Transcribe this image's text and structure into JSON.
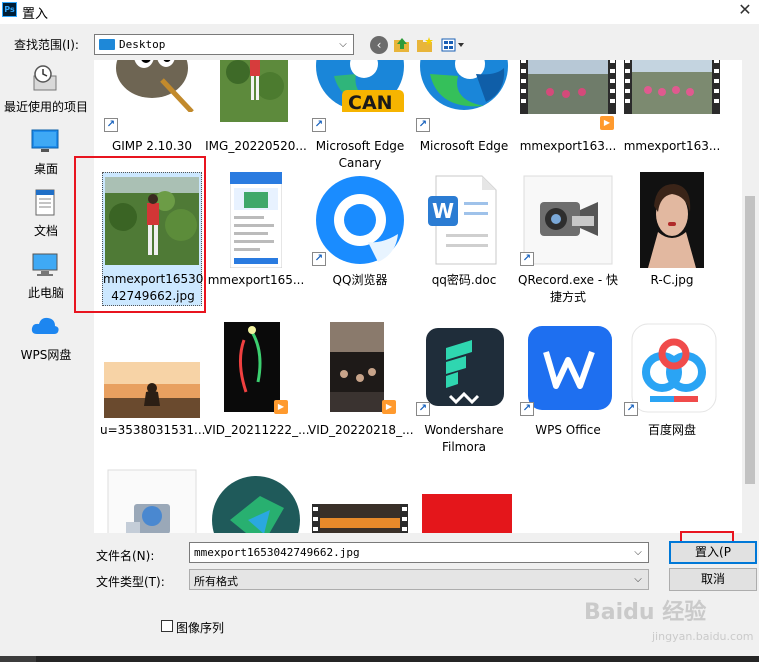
{
  "window": {
    "title": "置入",
    "app_icon": "Ps",
    "close_glyph": "✕"
  },
  "location": {
    "label": "查找范围(I):",
    "value": "Desktop"
  },
  "places": [
    {
      "label": "最近使用的项目",
      "icon": "recent-icon"
    },
    {
      "label": "桌面",
      "icon": "desktop-icon"
    },
    {
      "label": "文档",
      "icon": "documents-icon"
    },
    {
      "label": "此电脑",
      "icon": "computer-icon"
    },
    {
      "label": "WPS网盘",
      "icon": "cloud-icon"
    }
  ],
  "files": {
    "row1": [
      {
        "name": "GIMP 2.10.30"
      },
      {
        "name": "IMG_20220520..."
      },
      {
        "name": "Microsoft Edge\nCanary",
        "badge": "CAN"
      },
      {
        "name": "Microsoft Edge"
      },
      {
        "name": "mmexport163..."
      },
      {
        "name": "mmexport163..."
      }
    ],
    "row2": [
      {
        "name": "mmexport16530\n42749662.jpg"
      },
      {
        "name": "mmexport165..."
      },
      {
        "name": "QQ浏览器"
      },
      {
        "name": "qq密码.doc"
      },
      {
        "name": "QRecord.exe - 快\n捷方式"
      },
      {
        "name": "R-C.jpg"
      }
    ],
    "row3": [
      {
        "name": "u=3538031531..."
      },
      {
        "name": "VID_20211222_..."
      },
      {
        "name": "VID_20220218_..."
      },
      {
        "name": "Wondershare\nFilmora"
      },
      {
        "name": "WPS Office"
      },
      {
        "name": "百度网盘"
      }
    ]
  },
  "filename": {
    "label": "文件名(N):",
    "value": "mmexport1653042749662.jpg"
  },
  "filetype": {
    "label": "文件类型(T):",
    "value": "所有格式"
  },
  "buttons": {
    "place": "置入(P",
    "cancel": "取消"
  },
  "image_sequence": {
    "label": "图像序列"
  },
  "watermark": {
    "text": "Baidu 经验",
    "url": "jingyan.baidu.com"
  },
  "colors": {
    "highlight_red": "#e8141f",
    "selection_blue": "#cce8ff"
  }
}
